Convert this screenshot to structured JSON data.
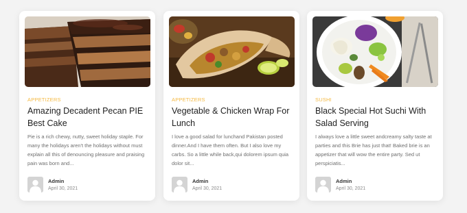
{
  "cards": [
    {
      "category": "APPETIZERS",
      "title": "Amazing Decadent Pecan PIE Best Cake",
      "excerpt": "Pie is a rich chewy, nutty, sweet holiday staple. For many the holidays aren't the holidays without must explain all this  of denouncing pleasure and praising pain was born and...",
      "author": "Admin",
      "date": "April 30, 2021",
      "image": "cake-image"
    },
    {
      "category": "APPETIZERS",
      "title": "Vegetable & Chicken Wrap For Lunch",
      "excerpt": "I love a good salad for lunchand Pakistan posted dinner.And I have them often. But I also love my carbs. So a little while back,qui dolorem ipsum quia dolor sit...",
      "author": "Admin",
      "date": "April 30, 2021",
      "image": "wrap-image"
    },
    {
      "category": "SUSHI",
      "title": "Black Special Hot Suchi With Salad Serving",
      "excerpt": "I always love a little sweet andcreamy salty taste at parties and this Brie has just that! Baked brie is an appetizer that will wow the entire party. Sed ut perspiciatis...",
      "author": "Admin",
      "date": "April 30, 2021",
      "image": "salad-image"
    }
  ],
  "colors": {
    "category": "#f4b942",
    "title": "#1e1e1e",
    "excerpt": "#6e6e6e",
    "background": "#f3f3f3"
  }
}
